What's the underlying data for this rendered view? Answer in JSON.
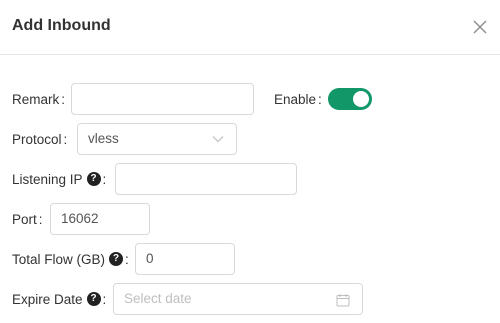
{
  "modal": {
    "title": "Add Inbound",
    "close_icon": "close-icon"
  },
  "form": {
    "remark": {
      "label": "Remark",
      "value": ""
    },
    "enable": {
      "label": "Enable",
      "checked": true,
      "color": "#129769"
    },
    "protocol": {
      "label": "Protocol",
      "value": "vless",
      "icon": "chevron-down-icon"
    },
    "listening_ip": {
      "label": "Listening IP",
      "value": "",
      "help_icon": "question-circle-icon"
    },
    "port": {
      "label": "Port",
      "value": "16062"
    },
    "total_flow": {
      "label": "Total Flow (GB)",
      "value": "0",
      "help_icon": "question-circle-icon"
    },
    "expire_date": {
      "label": "Expire Date",
      "placeholder": "Select date",
      "help_icon": "question-circle-icon",
      "icon": "calendar-icon"
    }
  }
}
